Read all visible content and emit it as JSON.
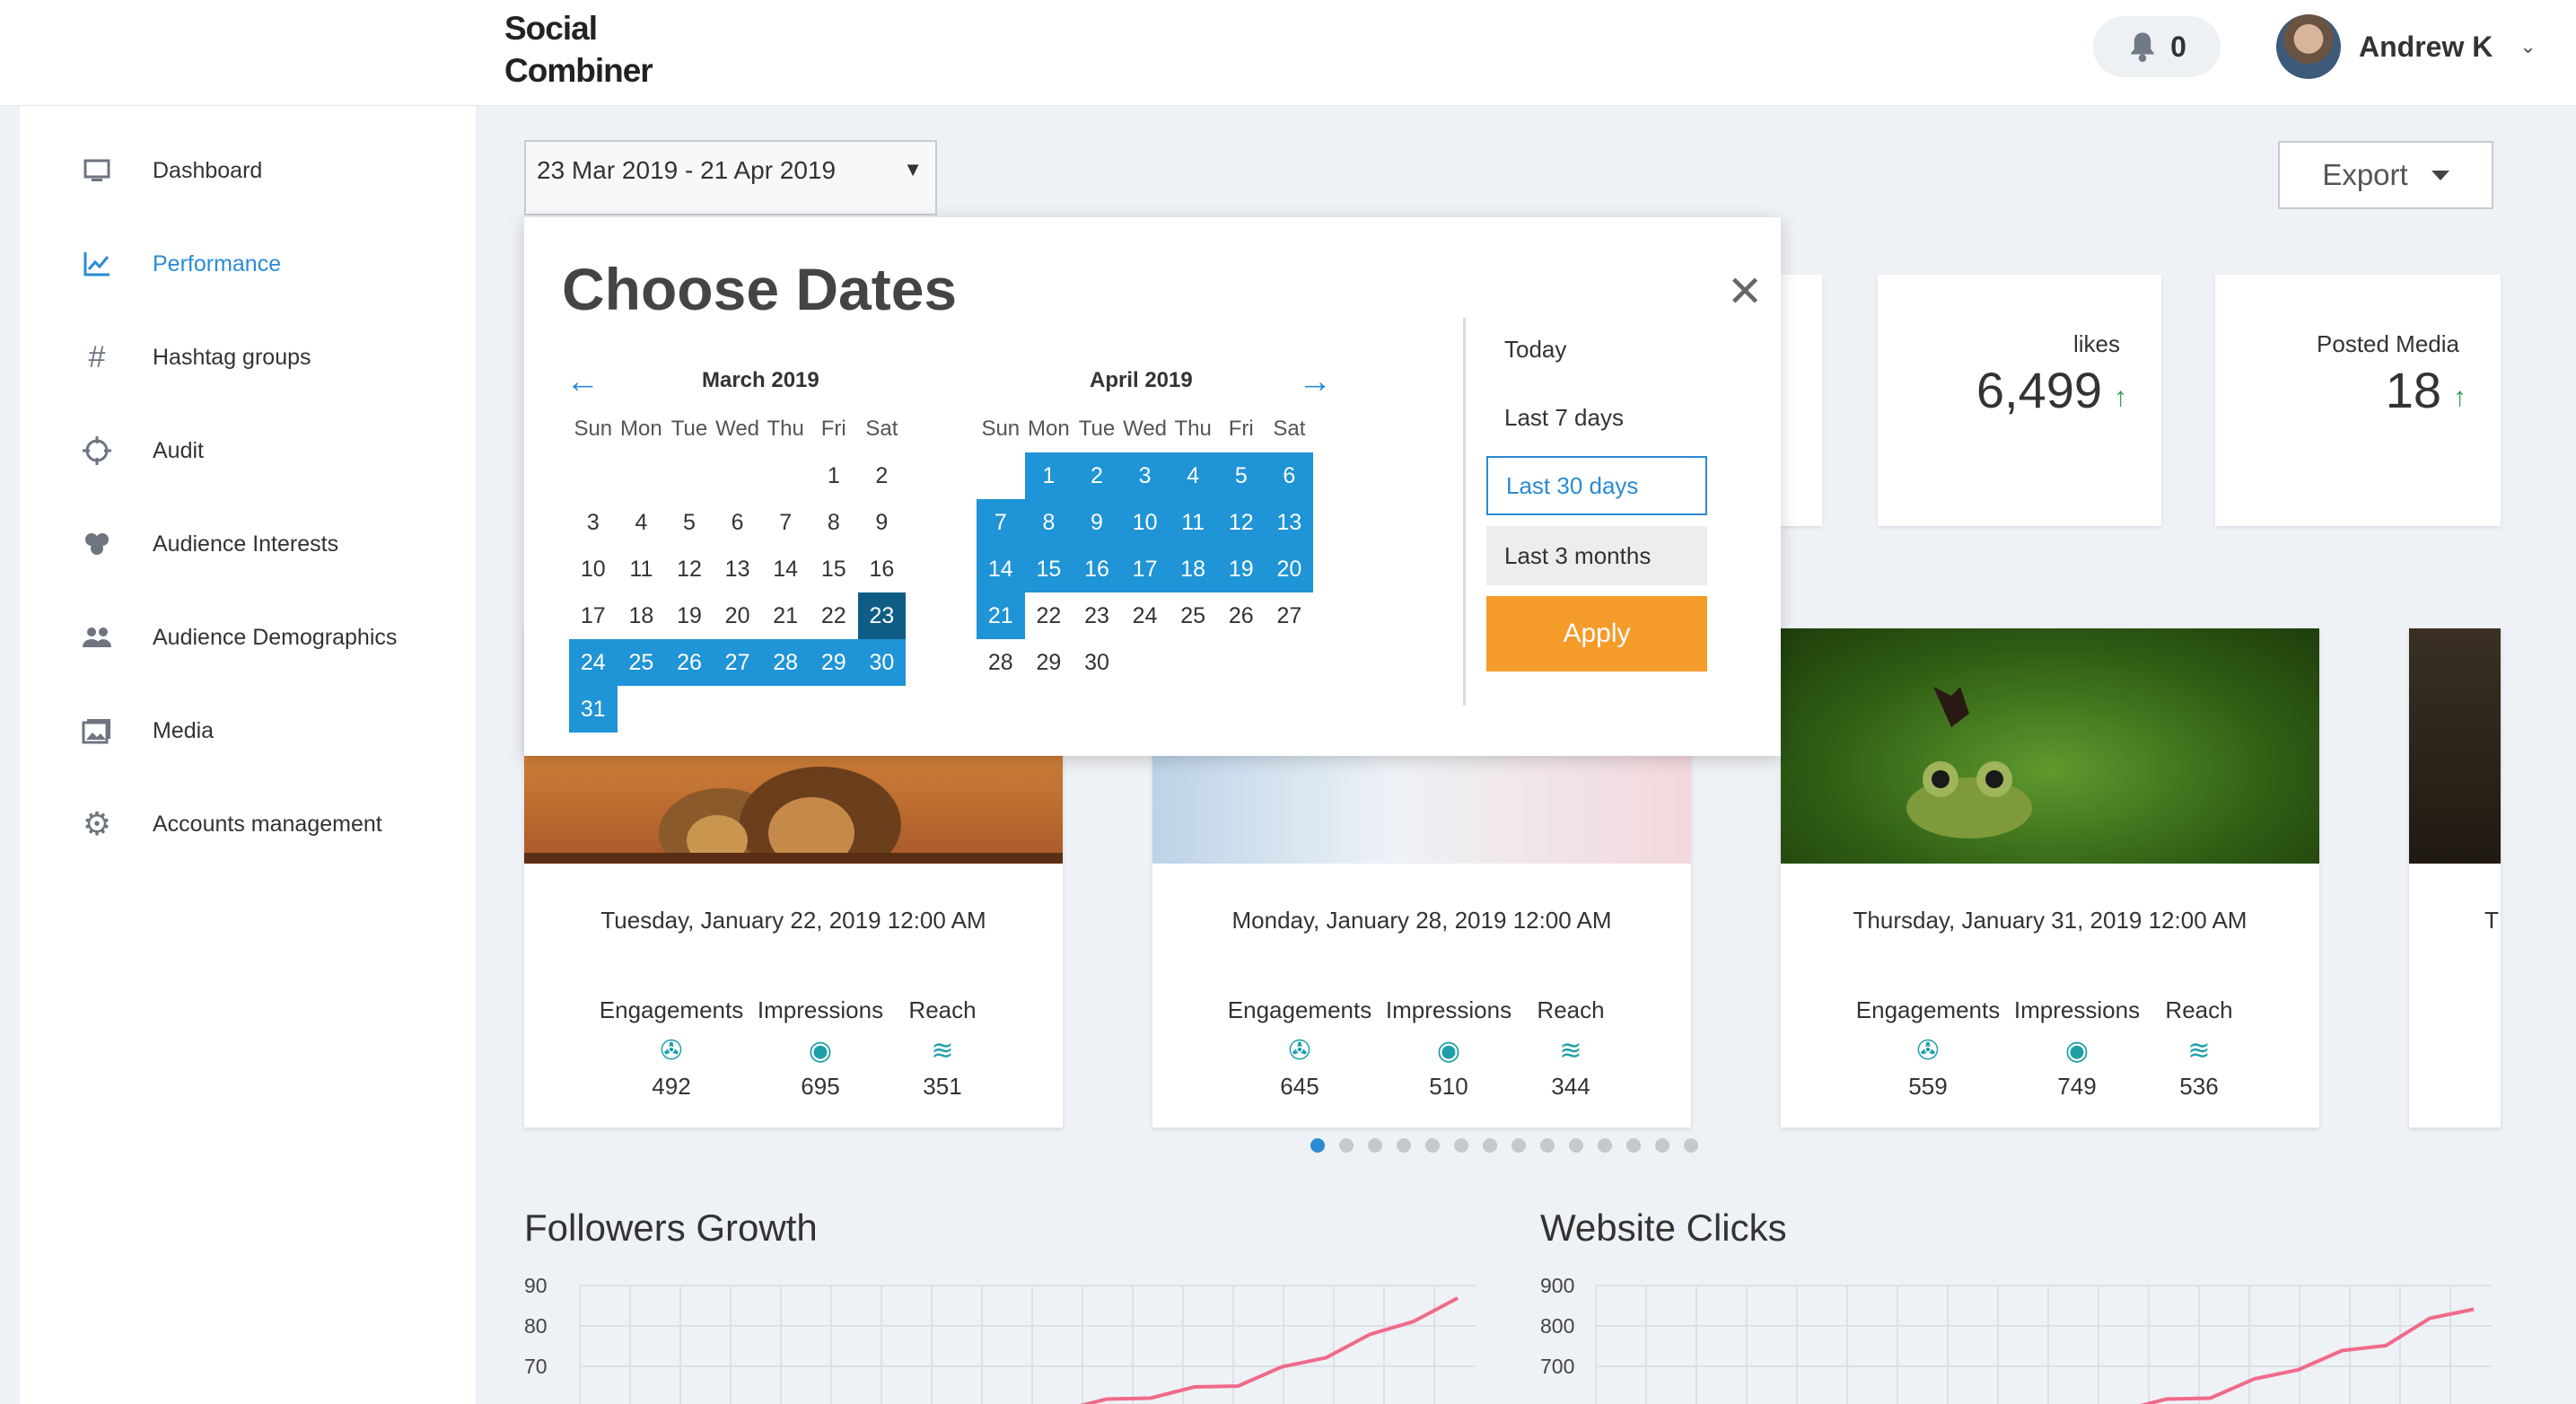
{
  "header": {
    "logo_line1": "Social",
    "logo_line2": "Combiner",
    "notifications_count": "0",
    "user_name": "Andrew K"
  },
  "sidebar": {
    "items": [
      {
        "label": "Dashboard",
        "icon": "monitor-icon"
      },
      {
        "label": "Performance",
        "icon": "line-chart-icon",
        "active": true
      },
      {
        "label": "Hashtag groups",
        "icon": "hashtag-icon"
      },
      {
        "label": "Audit",
        "icon": "crosshair-icon"
      },
      {
        "label": "Audience Interests",
        "icon": "clover-icon"
      },
      {
        "label": "Audience Demographics",
        "icon": "people-icon"
      },
      {
        "label": "Media",
        "icon": "photos-icon"
      },
      {
        "label": "Accounts management",
        "icon": "gear-icon"
      }
    ]
  },
  "date_range": {
    "value": "23 Mar 2019 - 21 Apr 2019"
  },
  "export": {
    "label": "Export"
  },
  "stats": [
    {
      "label": "likes",
      "value": "6,499"
    },
    {
      "label": "Posted Media",
      "value": "18"
    }
  ],
  "posts": [
    {
      "date": "Tuesday, January 22, 2019 12:00 AM",
      "engagements": "492",
      "impressions": "695",
      "reach": "351"
    },
    {
      "date": "Monday, January 28, 2019 12:00 AM",
      "engagements": "645",
      "impressions": "510",
      "reach": "344"
    },
    {
      "date": "Thursday, January 31, 2019 12:00 AM",
      "engagements": "559",
      "impressions": "749",
      "reach": "536"
    },
    {
      "date": "Tı"
    }
  ],
  "metric_labels": {
    "engagements": "Engagements",
    "impressions": "Impressions",
    "reach": "Reach"
  },
  "carousel": {
    "dot_count": 14,
    "active_index": 0
  },
  "datepicker": {
    "title": "Choose Dates",
    "weekdays": [
      "Sun",
      "Mon",
      "Tue",
      "Wed",
      "Thu",
      "Fri",
      "Sat"
    ],
    "left_month": {
      "name": "March 2019",
      "first_weekday": 5,
      "days": 31,
      "selected_from": 23,
      "selected_to": 31,
      "start_day": 23
    },
    "right_month": {
      "name": "April 2019",
      "first_weekday": 1,
      "days": 30,
      "selected_from": 1,
      "selected_to": 21
    },
    "ranges": [
      "Today",
      "Last 7 days",
      "Last 30 days",
      "Last 3 months"
    ],
    "active_range": "Last 30 days",
    "apply_label": "Apply"
  },
  "charts": {
    "followers": {
      "title": "Followers Growth"
    },
    "clicks": {
      "title": "Website Clicks"
    }
  },
  "chart_data": [
    {
      "type": "line",
      "title": "Followers Growth",
      "yticks": [
        90,
        80,
        70
      ],
      "series_color": "#f06a8a",
      "x": [
        0.55,
        0.6,
        0.65,
        0.7,
        0.75,
        0.8,
        0.85,
        0.9,
        0.95,
        1.0
      ],
      "y": [
        60,
        61,
        63,
        64,
        66,
        69,
        73,
        77,
        82,
        86
      ]
    },
    {
      "type": "line",
      "title": "Website Clicks",
      "yticks": [
        900,
        800,
        700
      ],
      "series_color": "#f06a8a",
      "x": [
        0.6,
        0.65,
        0.7,
        0.75,
        0.8,
        0.85,
        0.9,
        0.95,
        1.0
      ],
      "y": [
        600,
        610,
        630,
        660,
        700,
        730,
        760,
        810,
        850
      ]
    }
  ]
}
